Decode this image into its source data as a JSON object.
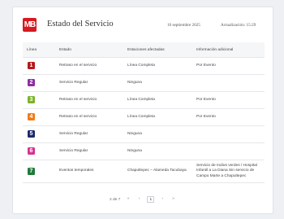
{
  "header": {
    "logo_text": "MB",
    "title": "Estado del Servicio",
    "date": "16 septiembre 2025",
    "updated_label": "Actualización: 15:29"
  },
  "table": {
    "columns": [
      "Línea",
      "Estado",
      "Estaciones afectadas",
      "Información adicional"
    ],
    "rows": [
      {
        "line": "1",
        "color": "#b5171d",
        "status": "Retraso en el servicio",
        "stations": "Línea Completa",
        "info": "Por Evento"
      },
      {
        "line": "2",
        "color": "#8e2ea0",
        "status": "Servicio Regular",
        "stations": "Ninguna",
        "info": ""
      },
      {
        "line": "3",
        "color": "#7cb32c",
        "status": "Retraso en el servicio",
        "stations": "Línea Completa",
        "info": "Por Evento"
      },
      {
        "line": "4",
        "color": "#ef7d1a",
        "status": "Retraso en el servicio",
        "stations": "Línea Completa",
        "info": "Por Evento"
      },
      {
        "line": "5",
        "color": "#1c2a6e",
        "status": "Servicio Regular",
        "stations": "Ninguna",
        "info": ""
      },
      {
        "line": "6",
        "color": "#d6338f",
        "status": "Servicio Regular",
        "stations": "Ninguna",
        "info": ""
      },
      {
        "line": "7",
        "color": "#1f7a3a",
        "status": "Eventos temporales",
        "stations": "Chapultepec – Alameda Tacubaya",
        "info": "Servicio de Indios verdes / Hospital Infantil a La Diana Sin servicio de Campo Marte a Chapultepec"
      }
    ]
  },
  "pager": {
    "page_label": "2 de 7",
    "first": "«",
    "prev": "‹",
    "current": "1",
    "next": "›",
    "last": "»"
  }
}
